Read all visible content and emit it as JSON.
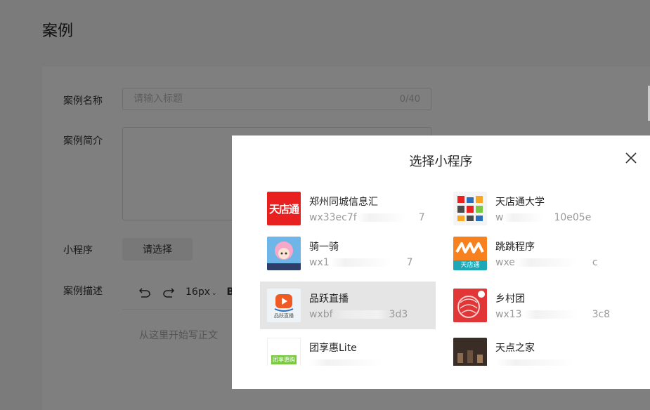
{
  "page": {
    "title": "案例"
  },
  "form": {
    "name_label": "案例名称",
    "name_placeholder": "请输入标题",
    "name_counter": "0/40",
    "intro_label": "案例简介",
    "miniprogram_label": "小程序",
    "choose_button": "请选择",
    "desc_label": "案例描述",
    "font_size": "16px",
    "bold": "B",
    "editor_placeholder": "从这里开始写正文"
  },
  "modal": {
    "title": "选择小程序",
    "items": [
      {
        "name": "郑州同城信息汇",
        "appid_start": "wx33ec7f",
        "appid_end": "7",
        "logo_text": "天店通",
        "logo_color": "#e8201f",
        "selected": false
      },
      {
        "name": "天店通大学",
        "appid_start": "w",
        "appid_end": "10e05e",
        "logo_text": "",
        "logo_color": "#f4f4f4",
        "selected": false
      },
      {
        "name": "骑一骑",
        "appid_start": "wx1",
        "appid_end": "7",
        "logo_text": "",
        "logo_color": "#8fd3f4",
        "selected": false
      },
      {
        "name": "跳跳程序",
        "appid_start": "wxe",
        "appid_end": "c",
        "logo_text": "天店通",
        "logo_color": "#f7811e",
        "selected": false
      },
      {
        "name": "品跃直播",
        "appid_start": "wxbf",
        "appid_end": "3d3",
        "logo_text": "品跃直播",
        "logo_color": "#ffffff",
        "selected": true
      },
      {
        "name": "乡村团",
        "appid_start": "wx13",
        "appid_end": "3c8",
        "logo_text": "",
        "logo_color": "#e82c2c",
        "selected": false
      },
      {
        "name": "团享惠Lite",
        "appid_start": "",
        "appid_end": "",
        "logo_text": "团享惠购",
        "logo_color": "#ffffff",
        "selected": false
      },
      {
        "name": "天点之家",
        "appid_start": "",
        "appid_end": "",
        "logo_text": "",
        "logo_color": "#3a2d26",
        "selected": false
      }
    ]
  },
  "colors": {
    "overlay": "rgba(0,0,0,0.5)",
    "brand_red": "#e8201f",
    "selected_bg": "#e5e5e5"
  }
}
